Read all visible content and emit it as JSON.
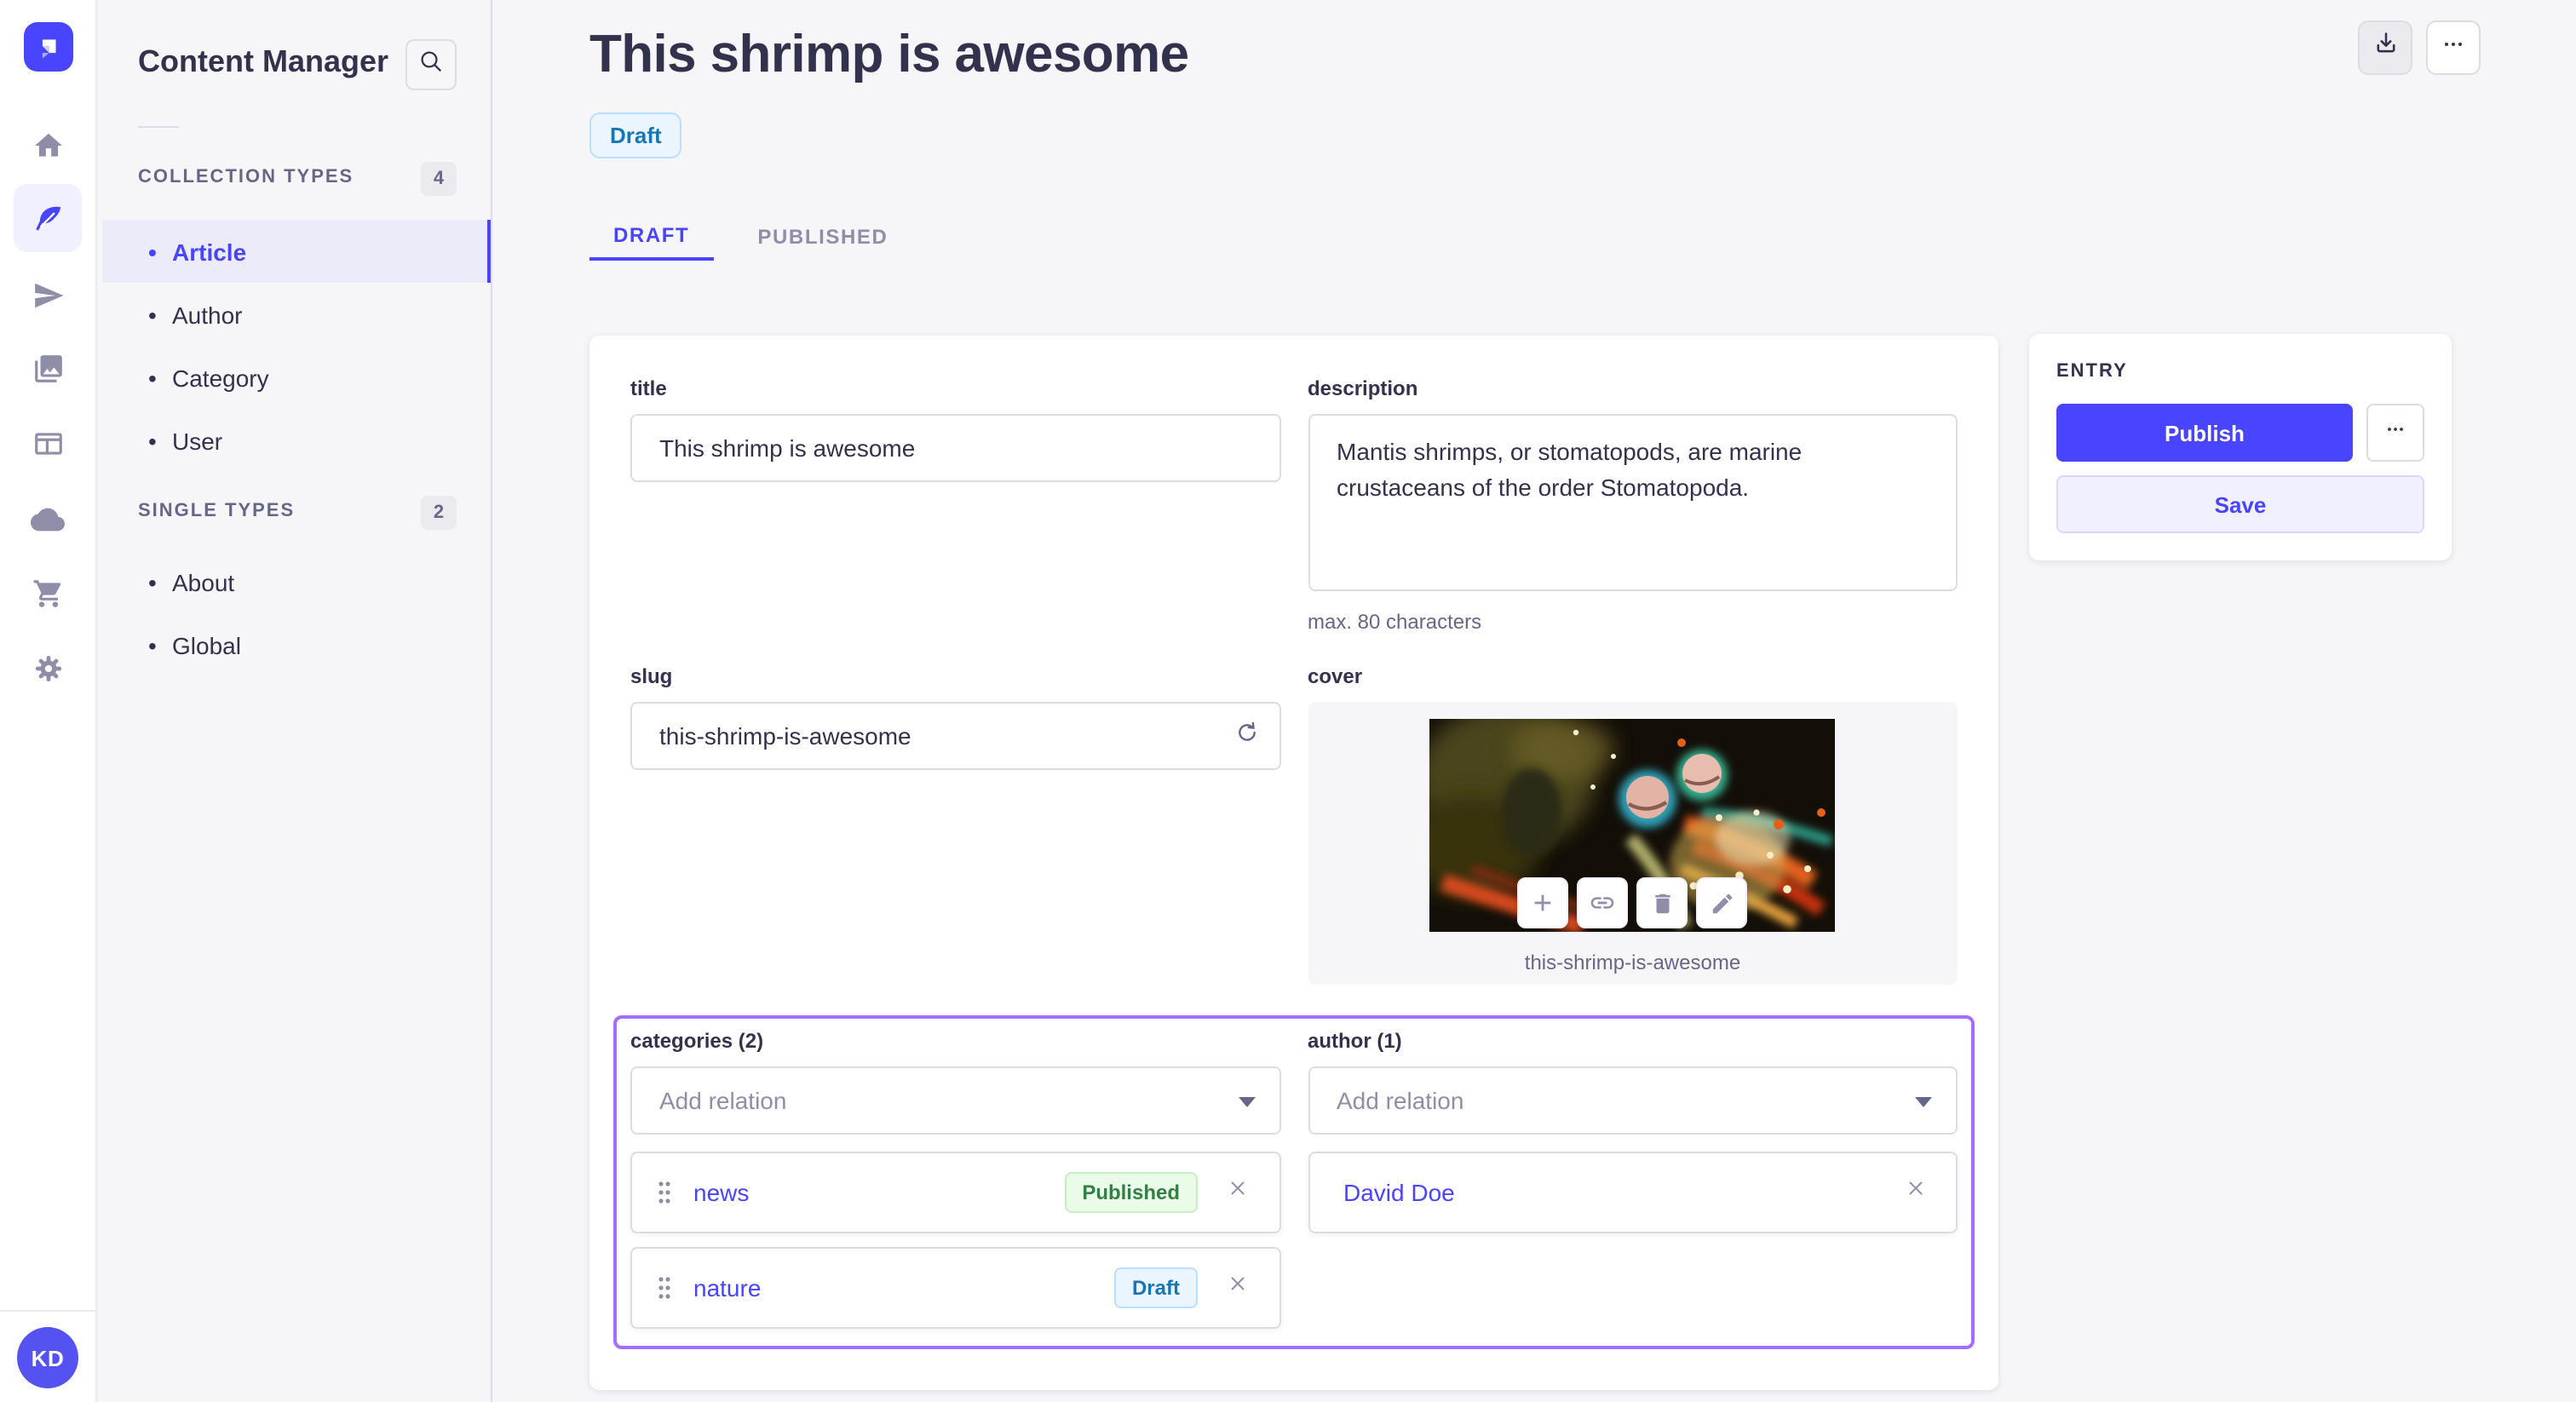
{
  "colors": {
    "accent": "#4945ff",
    "page_bg": "#f6f6f9",
    "success_text": "#328048",
    "success_bg": "#eafbe7",
    "success_border": "#c6f0c2",
    "draft_text": "#1577b5",
    "draft_bg": "#eaf5ff",
    "draft_border": "#b8e1ff",
    "highlight_border": "#a56efa"
  },
  "icon_rail": {
    "logo_icon": "strapi-logo-icon",
    "items": [
      {
        "icon": "home-icon",
        "active": false
      },
      {
        "icon": "feather-pen-icon",
        "active": true
      },
      {
        "icon": "paper-plane-icon",
        "active": false
      },
      {
        "icon": "media-library-icon",
        "active": false
      },
      {
        "icon": "layout-icon",
        "active": false
      },
      {
        "icon": "cloud-icon",
        "active": false
      },
      {
        "icon": "cart-icon",
        "active": false
      },
      {
        "icon": "gear-icon",
        "active": false
      }
    ],
    "avatar_initials": "KD"
  },
  "sidebar": {
    "title": "Content Manager",
    "search_icon": "search-icon",
    "sections": [
      {
        "label": "COLLECTION TYPES",
        "count": "4",
        "items": [
          {
            "label": "Article",
            "active": true
          },
          {
            "label": "Author",
            "active": false
          },
          {
            "label": "Category",
            "active": false
          },
          {
            "label": "User",
            "active": false
          }
        ]
      },
      {
        "label": "SINGLE TYPES",
        "count": "2",
        "items": [
          {
            "label": "About",
            "active": false
          },
          {
            "label": "Global",
            "active": false
          }
        ]
      }
    ]
  },
  "header": {
    "title": "This shrimp is awesome",
    "status_badge": "Draft",
    "tabs": [
      {
        "label": "DRAFT",
        "active": true
      },
      {
        "label": "PUBLISHED",
        "active": false
      }
    ],
    "actions": {
      "download_icon": "download-icon",
      "more_icon": "more-options-icon"
    }
  },
  "form": {
    "title": {
      "label": "title",
      "value": "This shrimp is awesome"
    },
    "description": {
      "label": "description",
      "value": "Mantis shrimps, or stomatopods, are marine crustaceans of the order Stomatopoda.",
      "hint": "max. 80 characters"
    },
    "slug": {
      "label": "slug",
      "value": "this-shrimp-is-awesome",
      "regenerate_icon": "refresh-icon"
    },
    "cover": {
      "label": "cover",
      "caption": "this-shrimp-is-awesome",
      "toolbar_icons": [
        "plus-icon",
        "link-icon",
        "trash-icon",
        "pencil-icon"
      ]
    },
    "categories": {
      "label": "categories (2)",
      "placeholder": "Add relation",
      "relations": [
        {
          "name": "news",
          "status": "Published"
        },
        {
          "name": "nature",
          "status": "Draft"
        }
      ]
    },
    "author": {
      "label": "author (1)",
      "placeholder": "Add relation",
      "relations": [
        {
          "name": "David Doe"
        }
      ]
    }
  },
  "entry_panel": {
    "title": "ENTRY",
    "publish_label": "Publish",
    "save_label": "Save",
    "more_icon": "more-options-icon"
  },
  "help_button": {
    "icon": "question-circle-icon"
  }
}
